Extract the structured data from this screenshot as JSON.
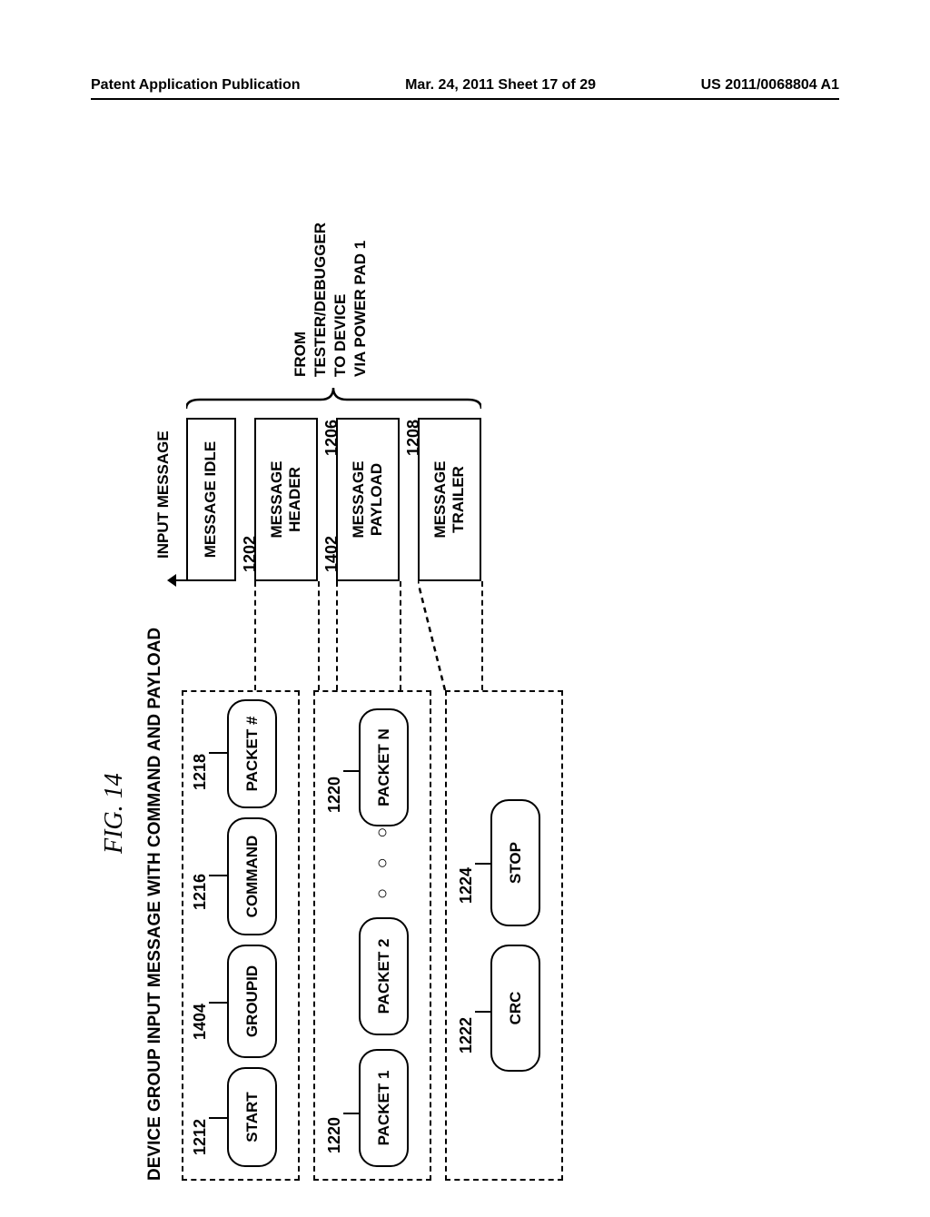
{
  "header": {
    "left": "Patent Application Publication",
    "center": "Mar. 24, 2011  Sheet 17 of 29",
    "right": "US 2011/0068804 A1"
  },
  "figure": {
    "title": "FIG. 14",
    "subtitle": "DEVICE GROUP INPUT MESSAGE WITH COMMAND AND PAYLOAD",
    "input_message_label": "INPUT MESSAGE",
    "header_group": {
      "boxes": [
        "START",
        "GROUPID",
        "COMMAND",
        "PACKET #"
      ],
      "refs": [
        "1212",
        "1404",
        "1216",
        "1218"
      ]
    },
    "payload_group": {
      "boxes": [
        "PACKET 1",
        "PACKET 2",
        "PACKET N"
      ],
      "dots": "○  ○  ○",
      "refs": [
        "1220",
        "1220"
      ]
    },
    "trailer_group": {
      "boxes": [
        "CRC",
        "STOP"
      ],
      "refs": [
        "1222",
        "1224"
      ]
    },
    "right_stack": {
      "boxes": [
        "MESSAGE IDLE",
        "MESSAGE\nHEADER",
        "MESSAGE\nPAYLOAD",
        "MESSAGE\nTRAILER"
      ],
      "refs": [
        "1202",
        "1402",
        "1206",
        "1208"
      ]
    },
    "brace_label": "FROM\nTESTER/DEBUGGER\nTO DEVICE\nVIA POWER PAD 1"
  }
}
